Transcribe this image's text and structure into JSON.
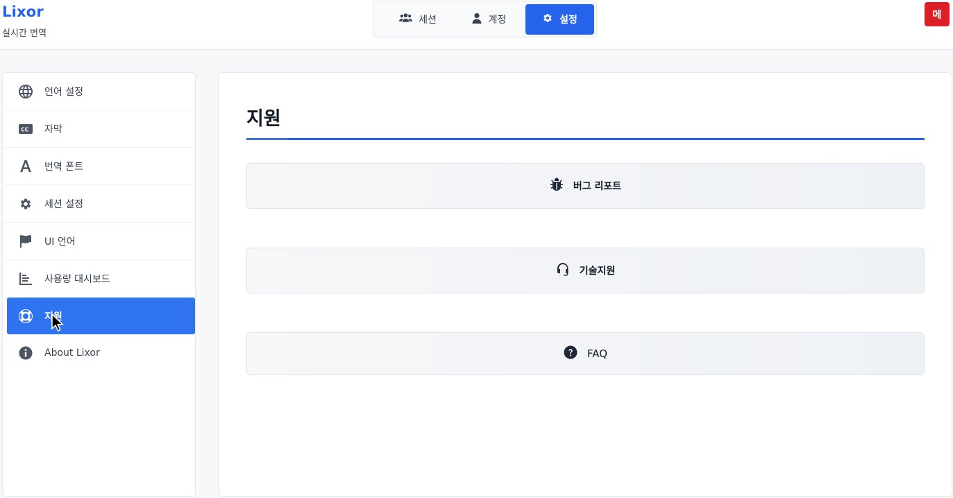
{
  "app": {
    "name": "Lixor",
    "subtitle": "실시간 번역",
    "menu_button": "메",
    "accent_color": "#2563eb",
    "menu_color": "#dc1f26"
  },
  "topnav": {
    "tabs": [
      {
        "label": "세션",
        "icon": "users-icon",
        "active": false
      },
      {
        "label": "계정",
        "icon": "user-icon",
        "active": false
      },
      {
        "label": "설정",
        "icon": "gear-icon",
        "active": true
      }
    ]
  },
  "sidebar": {
    "items": [
      {
        "label": "언어 설정",
        "icon": "globe-icon",
        "active": false
      },
      {
        "label": "자막",
        "icon": "closed-captions-icon",
        "active": false
      },
      {
        "label": "번역 폰트",
        "icon": "font-icon",
        "active": false
      },
      {
        "label": "세션 설정",
        "icon": "gear-icon",
        "active": false
      },
      {
        "label": "UI 언어",
        "icon": "flag-icon",
        "active": false
      },
      {
        "label": "사용량 대시보드",
        "icon": "chart-icon",
        "active": false
      },
      {
        "label": "지원",
        "icon": "lifebuoy-icon",
        "active": true
      },
      {
        "label": "About Lixor",
        "icon": "info-icon",
        "active": false
      }
    ]
  },
  "main": {
    "title": "지원",
    "actions": [
      {
        "label": "버그 리포트",
        "icon": "bug-icon"
      },
      {
        "label": "기술지원",
        "icon": "headset-icon"
      },
      {
        "label": "FAQ",
        "icon": "question-circle-icon"
      }
    ]
  }
}
